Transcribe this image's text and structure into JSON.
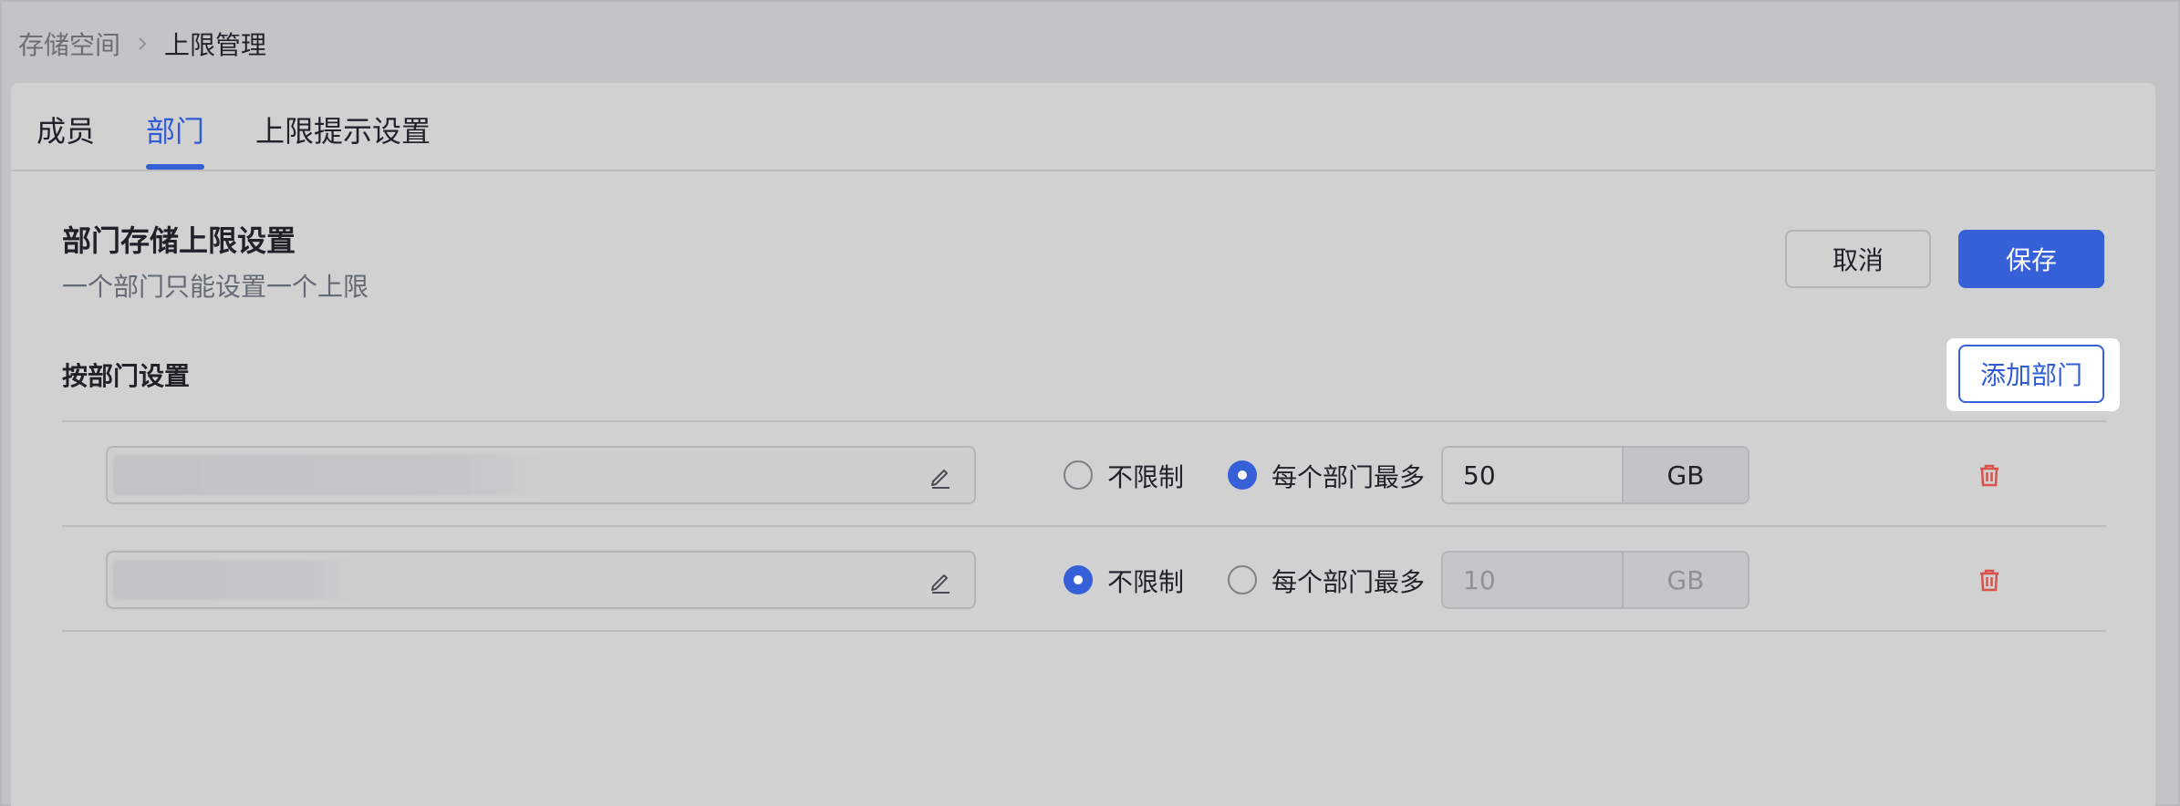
{
  "breadcrumb": {
    "parent": "存储空间",
    "current": "上限管理"
  },
  "tabs": [
    {
      "label": "成员",
      "active": false
    },
    {
      "label": "部门",
      "active": true
    },
    {
      "label": "上限提示设置",
      "active": false
    }
  ],
  "section": {
    "title": "部门存储上限设置",
    "subtitle": "一个部门只能设置一个上限"
  },
  "actions": {
    "cancel_label": "取消",
    "save_label": "保存"
  },
  "by_department": {
    "label": "按部门设置",
    "add_label": "添加部门"
  },
  "rows": [
    {
      "name": "",
      "unlimited_label": "不限制",
      "max_label": "每个部门最多",
      "mode": "max",
      "quota_value": "50",
      "unit": "GB"
    },
    {
      "name": "",
      "unlimited_label": "不限制",
      "max_label": "每个部门最多",
      "mode": "unlimited",
      "quota_value": "10",
      "unit": "GB"
    }
  ],
  "icons": {
    "breadcrumb_separator": "chevron-right-icon",
    "edit": "pencil-icon",
    "delete": "trash-icon"
  },
  "colors": {
    "accent": "#3560d8",
    "danger": "#d9534a",
    "background": "#c4c4c6"
  }
}
